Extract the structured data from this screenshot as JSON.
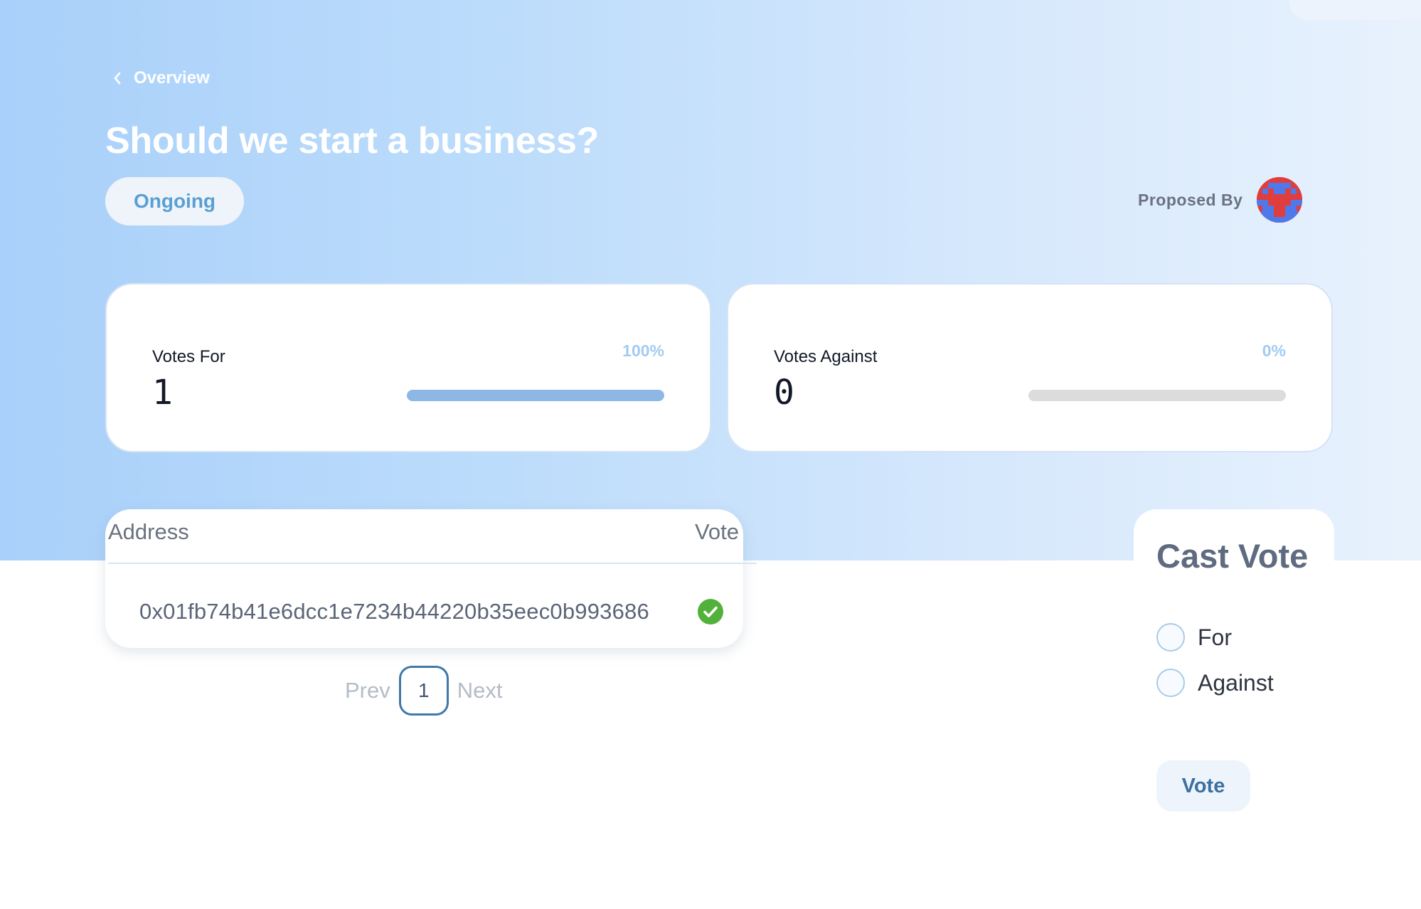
{
  "nav": {
    "back_label": "Overview"
  },
  "proposal": {
    "title": "Should we start a business?",
    "status": "Ongoing",
    "proposed_by_label": "Proposed By"
  },
  "stats": {
    "for": {
      "label": "Votes For",
      "value": "1",
      "percent": "100%",
      "fill_fraction": 1.0
    },
    "against": {
      "label": "Votes Against",
      "value": "0",
      "percent": "0%",
      "fill_fraction": 0.0
    }
  },
  "votes_table": {
    "headers": {
      "address": "Address",
      "vote": "Vote"
    },
    "rows": [
      {
        "address": "0x01fb74b41e6dcc1e7234b44220b35eec0b993686",
        "vote": "for",
        "icon": "check-circle-icon"
      }
    ]
  },
  "pagination": {
    "prev_label": "Prev",
    "current_page": "1",
    "next_label": "Next"
  },
  "cast_vote": {
    "title": "Cast Vote",
    "options": [
      "For",
      "Against"
    ],
    "submit_label": "Vote"
  },
  "colors": {
    "accent": "#5a9fd4",
    "bar_fill": "#8db8e6",
    "bar_track": "#dcdcdc",
    "check_green": "#52b13a",
    "pagination_border": "#3f79a9"
  }
}
